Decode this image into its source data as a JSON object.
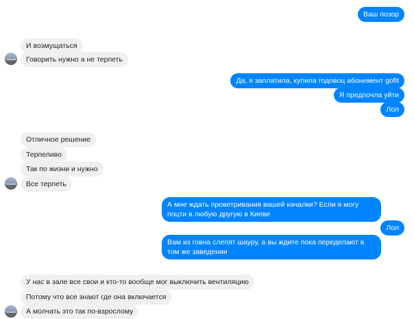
{
  "messages": {
    "m1": "Ваш позор",
    "m2": "И возмущаться",
    "m3": "Говорить нужно а не терпеть",
    "m4": "Да, я заплатила, купила годовоц абонемент gofit",
    "m5": "Я предпочла уйти",
    "m6": "Лол",
    "m7": "Отличное решение",
    "m8": "Терпеливо",
    "m9": "Так по жизни и нужно",
    "m10": "Все терпеть",
    "m11": "А мне ждать проветривания вашей качалки? Если я могу поцти в любую другую в Киеве",
    "m12": "Лол",
    "m13": "Вам из говна слепят шауру, а вы ждите пока переделают в том же заведении",
    "m14": "У нас в зале все свои и кто-то вообще мог выключить вентиляцию",
    "m15": "Потому что все знают где она включается",
    "m16": "А молчать это так по-взрослому"
  },
  "colors": {
    "outgoing_bubble": "#0084ff",
    "incoming_bubble": "#f1f0f0"
  }
}
